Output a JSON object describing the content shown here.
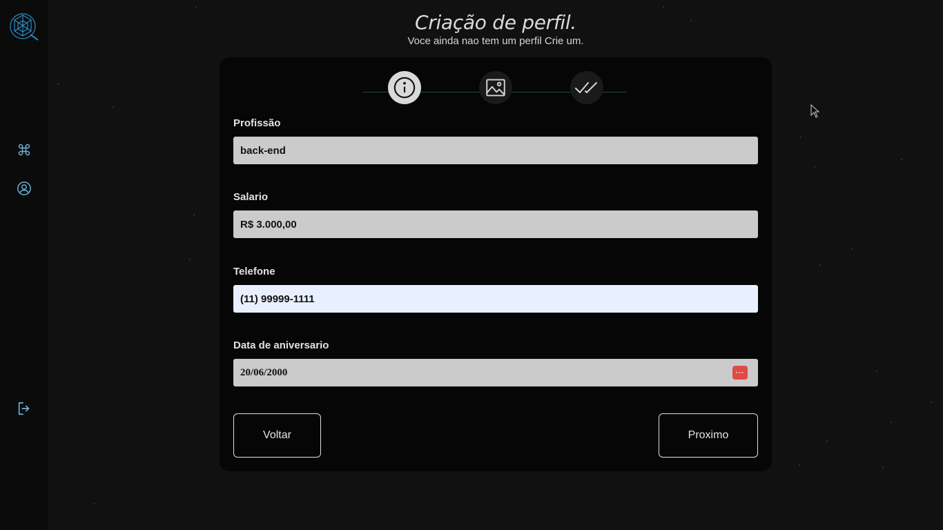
{
  "header": {
    "title": "Criação de perfil.",
    "subtitle": "Voce ainda nao tem um perfil Crie um."
  },
  "sidebar": {
    "items": [
      {
        "icon": "command-icon"
      },
      {
        "icon": "user-circle-icon"
      },
      {
        "icon": "logout-icon"
      }
    ]
  },
  "stepper": {
    "steps": [
      {
        "icon": "info-icon",
        "active": true
      },
      {
        "icon": "image-icon",
        "active": false
      },
      {
        "icon": "double-check-icon",
        "active": false
      }
    ]
  },
  "form": {
    "profissao": {
      "label": "Profissão",
      "value": "back-end"
    },
    "salario": {
      "label": "Salario",
      "value": "R$ 3.000,00"
    },
    "telefone": {
      "label": "Telefone",
      "value": "(11) 99999-1111"
    },
    "aniversario": {
      "label": "Data de aniversario",
      "value": "20/06/2000"
    }
  },
  "buttons": {
    "back": "Voltar",
    "next": "Proximo"
  },
  "colors": {
    "accent": "#2a8fc7",
    "card_bg": "#060606",
    "page_bg": "#111111",
    "input_bg": "#cbcbcb",
    "input_focused_bg": "#e8effe",
    "calendar_icon": "#e04a46"
  }
}
